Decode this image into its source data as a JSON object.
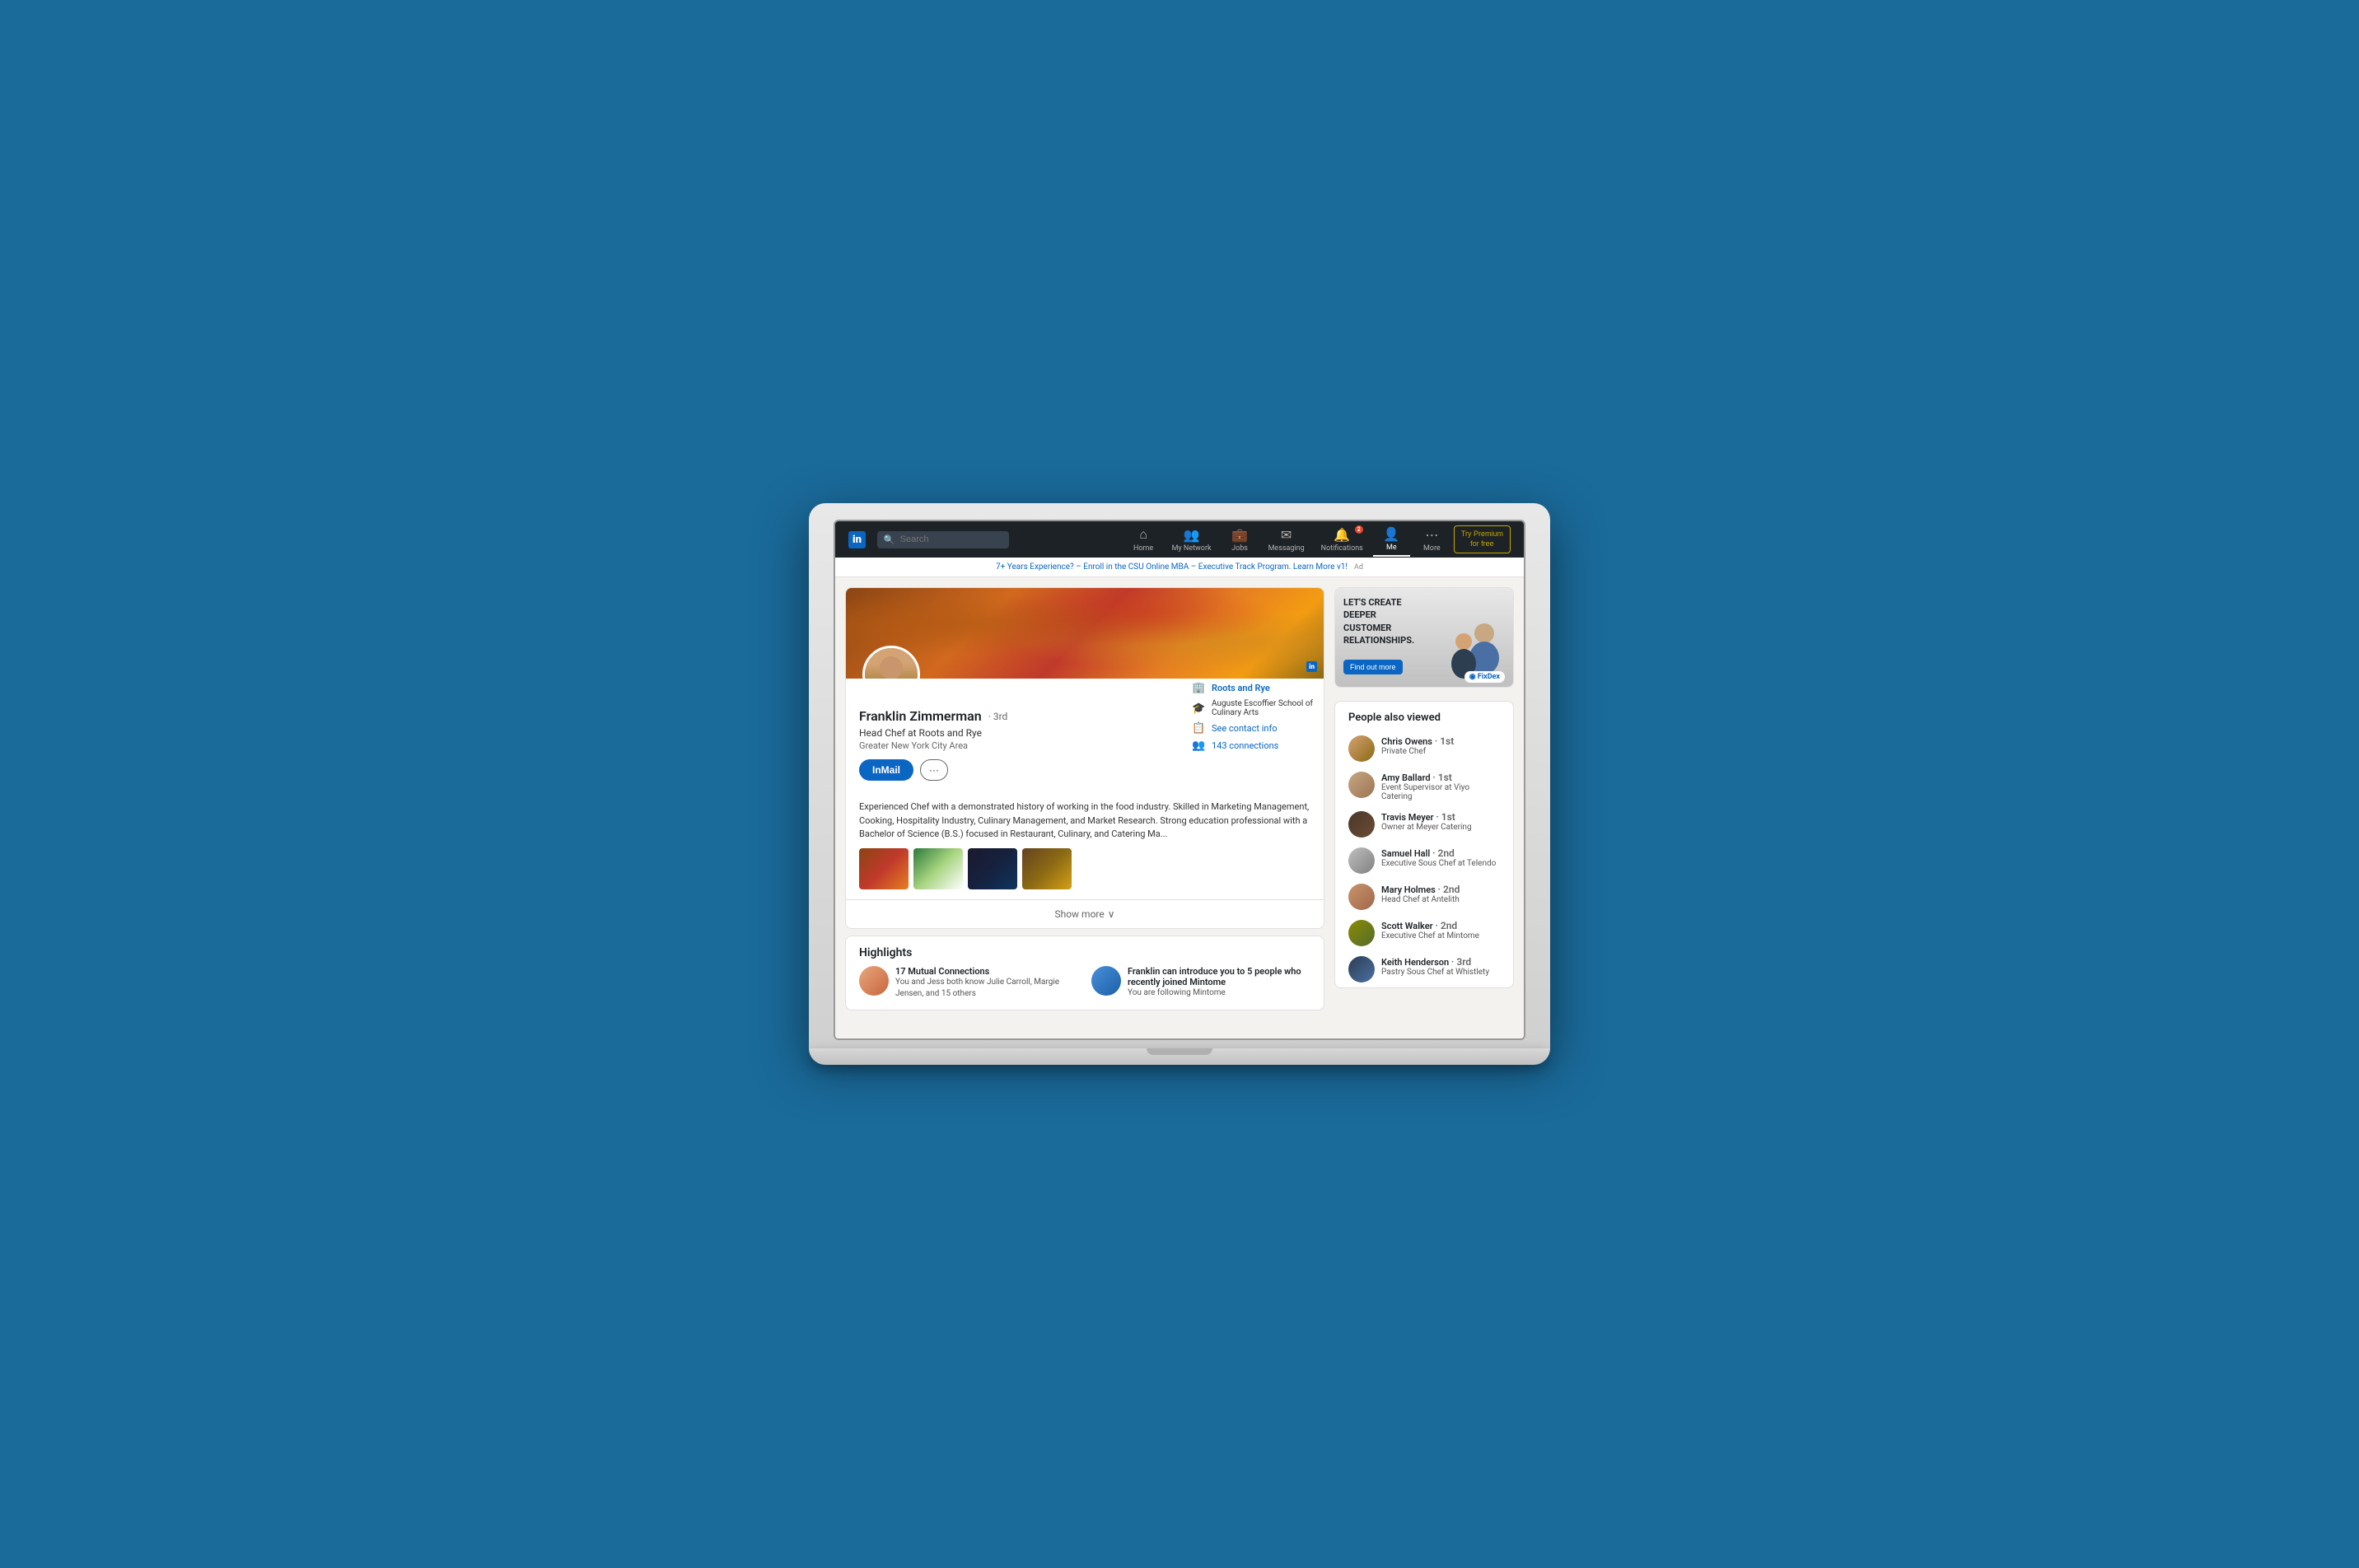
{
  "navbar": {
    "logo": "in",
    "search_placeholder": "Search",
    "items": [
      {
        "id": "home",
        "label": "Home",
        "icon": "⌂",
        "active": false
      },
      {
        "id": "my-network",
        "label": "My Network",
        "icon": "👥",
        "active": false
      },
      {
        "id": "jobs",
        "label": "Jobs",
        "icon": "💼",
        "active": false
      },
      {
        "id": "messaging",
        "label": "Messaging",
        "icon": "✉",
        "active": false
      },
      {
        "id": "notifications",
        "label": "Notifications",
        "icon": "🔔",
        "badge": "2",
        "active": false
      },
      {
        "id": "me",
        "label": "Me",
        "icon": "👤",
        "active": true
      },
      {
        "id": "more",
        "label": "More",
        "icon": "⋯",
        "active": false
      }
    ],
    "premium_label": "Try Premium",
    "premium_sub": "for free"
  },
  "ad_banner": {
    "text": "7+ Years Experience? – Enroll in the CSU Online MBA – Executive Track Program. Learn More v1!",
    "label": "Ad"
  },
  "profile": {
    "name": "Franklin Zimmerman",
    "degree": "· 3rd",
    "title": "Head Chef at Roots and Rye",
    "location": "Greater New York City Area",
    "btn_inmail": "InMail",
    "btn_more": "···",
    "employer": "Roots and Rye",
    "school": "Auguste Escoffier School of Culinary Arts",
    "contact_info": "See contact info",
    "connections": "143 connections",
    "summary": "Experienced Chef with a demonstrated history of working in the food industry. Skilled in Marketing Management, Cooking, Hospitality Industry, Culinary Management, and Market Research. Strong education professional with a Bachelor of Science (B.S.) focused in Restaurant, Culinary, and Catering Ma...",
    "show_more": "Show more"
  },
  "highlights": {
    "title": "Highlights",
    "items": [
      {
        "label": "17 Mutual Connections",
        "desc": "You and Jess both know Julie Carroll, Margie Jensen, and 15 others"
      },
      {
        "label": "Franklin can introduce you to 5 people who recently joined Mintome",
        "desc": "You are following Mintome"
      }
    ]
  },
  "ad_sidebar": {
    "headline": "LET'S CREATE DEEPER CUSTOMER RELATIONSHIPS.",
    "cta": "Find out more",
    "brand": "FixDex"
  },
  "people_also_viewed": {
    "title": "People also viewed",
    "people": [
      {
        "name": "Chris Owens",
        "degree": "· 1st",
        "title": "Private Chef"
      },
      {
        "name": "Amy Ballard",
        "degree": "· 1st",
        "title": "Event Supervisor at Viyo Catering"
      },
      {
        "name": "Travis Meyer",
        "degree": "· 1st",
        "title": "Owner at Meyer Catering"
      },
      {
        "name": "Samuel Hall",
        "degree": "· 2nd",
        "title": "Executive Sous Chef at Telendo"
      },
      {
        "name": "Mary Holmes",
        "degree": "· 2nd",
        "title": "Head Chef at Antelith"
      },
      {
        "name": "Scott Walker",
        "degree": "· 2nd",
        "title": "Executive Chef at Mintome"
      },
      {
        "name": "Keith Henderson",
        "degree": "· 3rd",
        "title": "Pastry Sous Chef at Whistlety"
      }
    ]
  }
}
